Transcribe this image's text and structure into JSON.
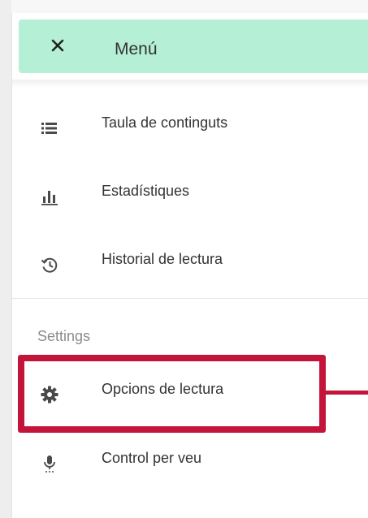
{
  "menu": {
    "title": "Menú",
    "items": [
      {
        "label": "Taula de continguts",
        "icon": "list-icon"
      },
      {
        "label": "Estadístiques",
        "icon": "bar-chart-icon"
      },
      {
        "label": "Historial de lectura",
        "icon": "history-icon"
      }
    ],
    "settings_section": {
      "title": "Settings",
      "items": [
        {
          "label": "Opcions de lectura",
          "icon": "gear-icon"
        },
        {
          "label": "Control per veu",
          "icon": "microphone-icon"
        }
      ]
    }
  },
  "colors": {
    "header_bg": "#b5efd6",
    "highlight": "#c3143a",
    "icon": "#4a4a4a",
    "section_title": "#8b8b8b"
  }
}
